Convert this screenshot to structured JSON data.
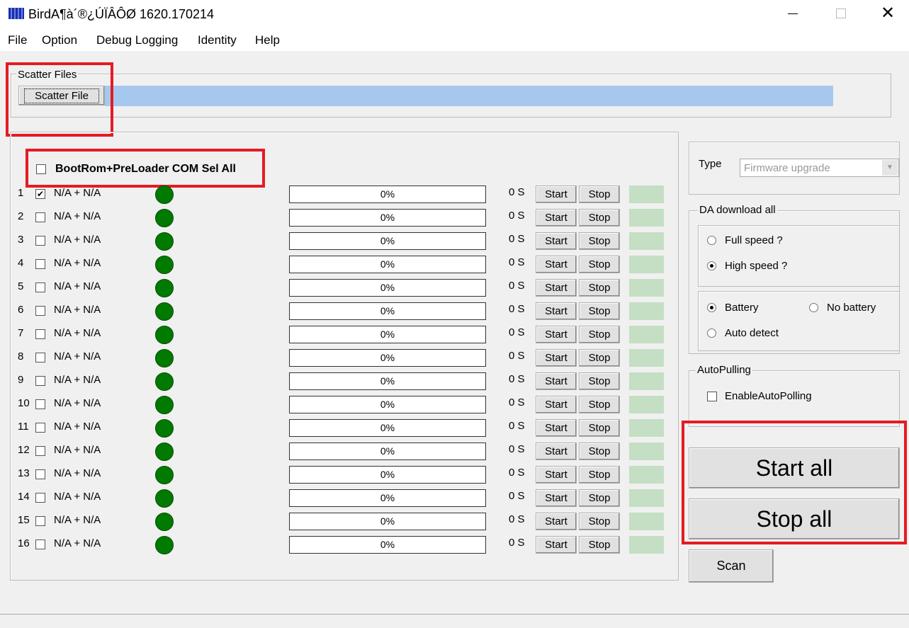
{
  "window": {
    "title": "BirdA¶à´®¿ÚÏÂÔØ 1620.170214",
    "app_icon": "bird-app-icon",
    "controls": [
      "minimize",
      "maximize",
      "close"
    ]
  },
  "menu": [
    "File",
    "Option",
    "Debug Logging",
    "Identity",
    "Help"
  ],
  "scatter": {
    "group_label": "Scatter Files",
    "button_label": "Scatter File",
    "path_value": ""
  },
  "ports": {
    "sel_all_label": "BootRom+PreLoader COM Sel All",
    "sel_all_checked": false,
    "rows": [
      {
        "num": "1",
        "checked": true,
        "label": "N/A + N/A",
        "progress": "0%",
        "time": "0 S"
      },
      {
        "num": "2",
        "checked": false,
        "label": "N/A + N/A",
        "progress": "0%",
        "time": "0 S"
      },
      {
        "num": "3",
        "checked": false,
        "label": "N/A + N/A",
        "progress": "0%",
        "time": "0 S"
      },
      {
        "num": "4",
        "checked": false,
        "label": "N/A + N/A",
        "progress": "0%",
        "time": "0 S"
      },
      {
        "num": "5",
        "checked": false,
        "label": "N/A + N/A",
        "progress": "0%",
        "time": "0 S"
      },
      {
        "num": "6",
        "checked": false,
        "label": "N/A + N/A",
        "progress": "0%",
        "time": "0 S"
      },
      {
        "num": "7",
        "checked": false,
        "label": "N/A + N/A",
        "progress": "0%",
        "time": "0 S"
      },
      {
        "num": "8",
        "checked": false,
        "label": "N/A + N/A",
        "progress": "0%",
        "time": "0 S"
      },
      {
        "num": "9",
        "checked": false,
        "label": "N/A + N/A",
        "progress": "0%",
        "time": "0 S"
      },
      {
        "num": "10",
        "checked": false,
        "label": "N/A + N/A",
        "progress": "0%",
        "time": "0 S"
      },
      {
        "num": "11",
        "checked": false,
        "label": "N/A + N/A",
        "progress": "0%",
        "time": "0 S"
      },
      {
        "num": "12",
        "checked": false,
        "label": "N/A + N/A",
        "progress": "0%",
        "time": "0 S"
      },
      {
        "num": "13",
        "checked": false,
        "label": "N/A + N/A",
        "progress": "0%",
        "time": "0 S"
      },
      {
        "num": "14",
        "checked": false,
        "label": "N/A + N/A",
        "progress": "0%",
        "time": "0 S"
      },
      {
        "num": "15",
        "checked": false,
        "label": "N/A + N/A",
        "progress": "0%",
        "time": "0 S"
      },
      {
        "num": "16",
        "checked": false,
        "label": "N/A + N/A",
        "progress": "0%",
        "time": "0 S"
      }
    ],
    "start_label": "Start",
    "stop_label": "Stop",
    "led_color": "#007a00",
    "status_color": "#c4dfc4"
  },
  "type": {
    "label": "Type",
    "value": "Firmware upgrade"
  },
  "da": {
    "group_label": "DA download all",
    "full_speed": "Full speed ?",
    "high_speed": "High speed ?",
    "speed_selected": "High speed ?",
    "battery": "Battery",
    "no_battery": "No battery",
    "auto_detect": "Auto detect",
    "battery_selected": "Battery"
  },
  "autopulling": {
    "group_label": "AutoPulling",
    "enable_label": "EnableAutoPolling",
    "enabled": false
  },
  "actions": {
    "start_all": "Start all",
    "stop_all": "Stop all",
    "scan": "Scan"
  },
  "highlight_color": "#e41b23"
}
